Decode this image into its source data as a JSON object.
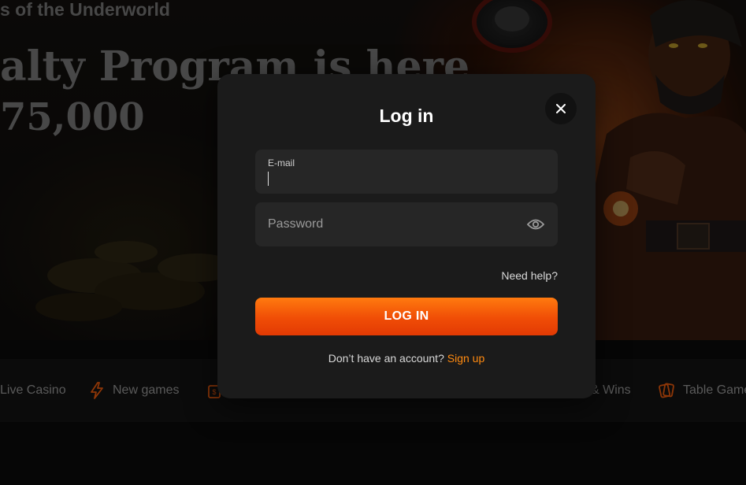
{
  "hero": {
    "subtitle": "s of the Underworld",
    "title": "alty Program is here",
    "amount": "75,000"
  },
  "categories": [
    {
      "label": "Live Casino",
      "icon": "live-casino-icon"
    },
    {
      "label": "New games",
      "icon": "lightning-icon"
    },
    {
      "label": "",
      "icon": "bonus-icon"
    },
    {
      "label": "& Wins",
      "icon": ""
    },
    {
      "label": "Table Game",
      "icon": "cards-icon"
    }
  ],
  "modal": {
    "title": "Log in",
    "close_icon": "close-icon",
    "email": {
      "label": "E-mail",
      "value": ""
    },
    "password": {
      "placeholder": "Password",
      "eye_icon": "eye-icon"
    },
    "need_help": "Need help?",
    "login_button": "LOG IN",
    "signup_prompt": "Don’t have an account?",
    "signup_link": "Sign up"
  },
  "colors": {
    "accent": "#ff7a0f",
    "button_gradient_end": "#e23a04",
    "modal_bg": "#1b1b1b",
    "field_bg": "#262626",
    "page_bg": "#0a0a0a"
  }
}
